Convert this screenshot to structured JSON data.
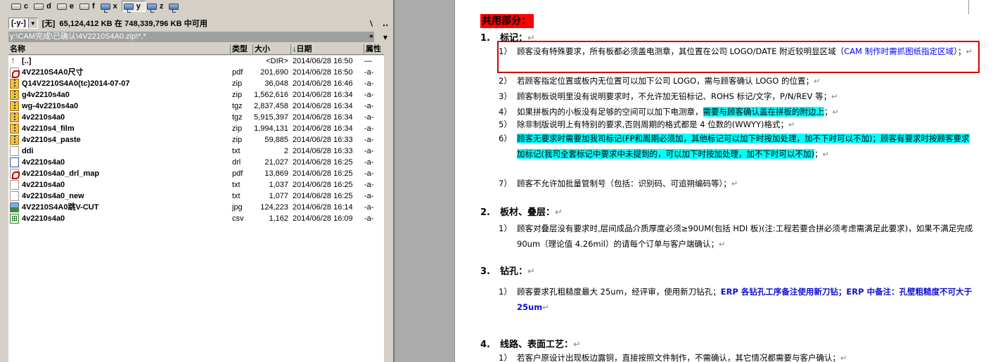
{
  "file_manager": {
    "drives": [
      {
        "letter": "c",
        "type": "local"
      },
      {
        "letter": "d",
        "type": "local"
      },
      {
        "letter": "e",
        "type": "local"
      },
      {
        "letter": "f",
        "type": "local"
      },
      {
        "letter": "x",
        "type": "network"
      },
      {
        "letter": "y",
        "type": "network",
        "active": true
      },
      {
        "letter": "z",
        "type": "network"
      }
    ],
    "drive_combo_value": "[-y-]",
    "volume_label": "[无]",
    "free_space": "65,124,412 KB 在 748,339,796 KB 中可用",
    "root_button": "\\",
    "parent_button": "..",
    "filter_button": "*",
    "current_path": "y:\\CAM完成\\已确认\\4V2210S4A0.zip\\*.*",
    "columns": {
      "name": "名称",
      "ext": "类型",
      "size": "大小",
      "date": "↓日期",
      "attr": "属性"
    },
    "files": [
      {
        "icon": "up",
        "name": "[..]",
        "ext": "",
        "size": "<DIR>",
        "date": "2014/06/28 16:50",
        "attr": "—"
      },
      {
        "icon": "pdf",
        "name": "4V2210S4A0尺寸",
        "ext": "pdf",
        "size": "201,690",
        "date": "2014/06/28 16:50",
        "attr": "-a-"
      },
      {
        "icon": "zip",
        "name": "Q14V2210S4A0(tc)2014-07-07",
        "ext": "zip",
        "size": "36,048",
        "date": "2014/06/28 16:46",
        "attr": "-a-"
      },
      {
        "icon": "zip",
        "name": "g4v2210s4a0",
        "ext": "zip",
        "size": "1,562,616",
        "date": "2014/06/28 16:34",
        "attr": "-a-"
      },
      {
        "icon": "zip",
        "name": "wg-4v2210s4a0",
        "ext": "tgz",
        "size": "2,837,458",
        "date": "2014/06/28 16:34",
        "attr": "-a-"
      },
      {
        "icon": "zip",
        "name": "4v2210s4a0",
        "ext": "tgz",
        "size": "5,915,397",
        "date": "2014/06/28 16:34",
        "attr": "-a-"
      },
      {
        "icon": "zip",
        "name": "4v2210s4_film",
        "ext": "zip",
        "size": "1,994,131",
        "date": "2014/06/28 16:34",
        "attr": "-a-"
      },
      {
        "icon": "zip",
        "name": "4v2210s4_paste",
        "ext": "zip",
        "size": "59,885",
        "date": "2014/06/28 16:33",
        "attr": "-a-"
      },
      {
        "icon": "txt",
        "name": "ddi",
        "ext": "txt",
        "size": "2",
        "date": "2014/06/28 16:33",
        "attr": "-a-"
      },
      {
        "icon": "drl",
        "name": "4v2210s4a0",
        "ext": "drl",
        "size": "21,027",
        "date": "2014/06/28 16:25",
        "attr": "-a-"
      },
      {
        "icon": "pdf",
        "name": "4v2210s4a0_drl_map",
        "ext": "pdf",
        "size": "13,869",
        "date": "2014/06/28 16:25",
        "attr": "-a-"
      },
      {
        "icon": "txt",
        "name": "4v2210s4a0",
        "ext": "txt",
        "size": "1,037",
        "date": "2014/06/28 16:25",
        "attr": "-a-"
      },
      {
        "icon": "txt",
        "name": "4v2210s4a0_new",
        "ext": "txt",
        "size": "1,077",
        "date": "2014/06/28 16:25",
        "attr": "-a-"
      },
      {
        "icon": "jpg",
        "name": "4V2210S4A0跳V-CUT",
        "ext": "jpg",
        "size": "124,223",
        "date": "2014/06/28 16:14",
        "attr": "-a-"
      },
      {
        "icon": "csv",
        "name": "4v2210s4a0",
        "ext": "csv",
        "size": "1,162",
        "date": "2014/06/28 16:09",
        "attr": "-a-"
      }
    ]
  },
  "document": {
    "title": "共用部分：",
    "title_color": "#ff0000",
    "highlight_color": "#00ffff",
    "sections": [
      {
        "num": "1.",
        "heading": "标记：",
        "items": [
          {
            "num": "1）",
            "parts": [
              {
                "t": "顾客没有特殊要求，所有板都必须盖电测章，其位置在公司 LOGO/DATE 附近较明显区域（"
              },
              {
                "t": "CAM 制作时需抓图纸指定区域",
                "style": "blue"
              },
              {
                "t": "）；"
              }
            ]
          },
          {
            "num": "2）",
            "parts": [
              {
                "t": "若顾客指定位置或板内无位置可以加下公司 LOGO，需与顾客确认 LOGO 的位置；"
              }
            ]
          },
          {
            "num": "3）",
            "parts": [
              {
                "t": "顾客制板说明里没有说明要求时，不允许加无铅标记、ROHS 标记/文字，P/N/REV 等；"
              }
            ]
          },
          {
            "num": "4）",
            "parts": [
              {
                "t": "如果拼板内的小板没有足够的空间可以加下电测章，"
              },
              {
                "t": "需要与顾客确认盖在拼板的附边上",
                "style": "hl"
              },
              {
                "t": "；"
              }
            ]
          },
          {
            "num": "5）",
            "parts": [
              {
                "t": "除非制版说明上有特别的要求,否则周期的格式都是 4 位数的(WWYY)格式；"
              }
            ]
          },
          {
            "num": "6）",
            "parts": [
              {
                "t": "顾客无要求时需要加我司标记(FP和周期必须加，其他标记可以加下时按加处理，加不下时可以不加)；顾客有要求时按顾客要求加标记(我司全套标记中要求中未提到的，可以加下时按加处理，加不下时可以不加)",
                "style": "hl"
              },
              {
                "t": "；"
              }
            ]
          },
          {
            "num": "7）",
            "parts": [
              {
                "t": "顾客不允许加批量管制号（包括：识别码、可追朔编码等）；"
              }
            ]
          }
        ]
      },
      {
        "num": "2.",
        "heading": "板材、叠层：",
        "items": [
          {
            "num": "1）",
            "parts": [
              {
                "t": "顾客对叠层没有要求时,层间成品介质厚度必须≥90UM(包括 HDI 板)(注:工程若要合拼必须考虑需满足此要求)，如果不满足完成 90um（理论值 4.26mil）的请每个订单与客户端确认；"
              }
            ]
          }
        ]
      },
      {
        "num": "3.",
        "heading": "钻孔：",
        "items": [
          {
            "num": "1）",
            "parts": [
              {
                "t": "顾客要求孔粗糙度最大 25um，经评审，使用新刀钻孔；"
              },
              {
                "t": "ERP 各钻孔工序备注使用新刀钻；ERP 中备注：孔壁粗糙度不可大于 25um",
                "style": "boldblue"
              }
            ]
          }
        ]
      },
      {
        "num": "4.",
        "heading": "线路、表面工艺：",
        "items": [
          {
            "num": "1）",
            "parts": [
              {
                "t": "若客户原设计出现板边露铜，直接按照文件制作，不需确认，其它情况都需要与客户确认；"
              }
            ]
          }
        ]
      }
    ]
  }
}
